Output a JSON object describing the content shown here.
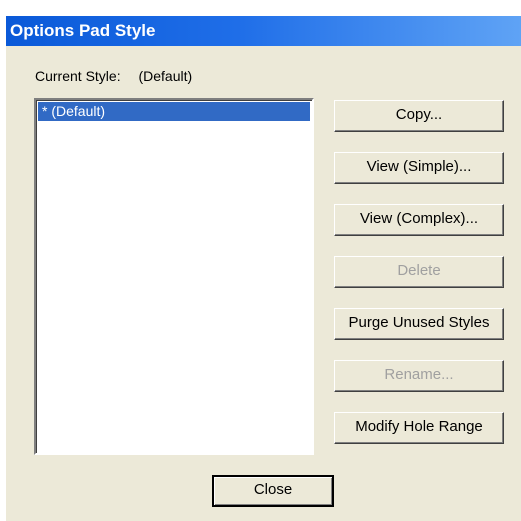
{
  "window": {
    "title": "Options Pad Style"
  },
  "current_style": {
    "label": "Current Style:",
    "value": "(Default)"
  },
  "styles_list": {
    "items": [
      {
        "label": "* (Default)",
        "selected": true
      }
    ]
  },
  "buttons": {
    "copy": "Copy...",
    "view_simple": "View (Simple)...",
    "view_complex": "View (Complex)...",
    "delete": "Delete",
    "purge": "Purge Unused Styles",
    "rename": "Rename...",
    "modify_hole_range": "Modify Hole Range",
    "close": "Close"
  },
  "colors": {
    "titlebar_start": "#0a59d8",
    "titlebar_end": "#5fa3f5",
    "dialog_bg": "#ece9d8",
    "selection": "#316ac5"
  }
}
